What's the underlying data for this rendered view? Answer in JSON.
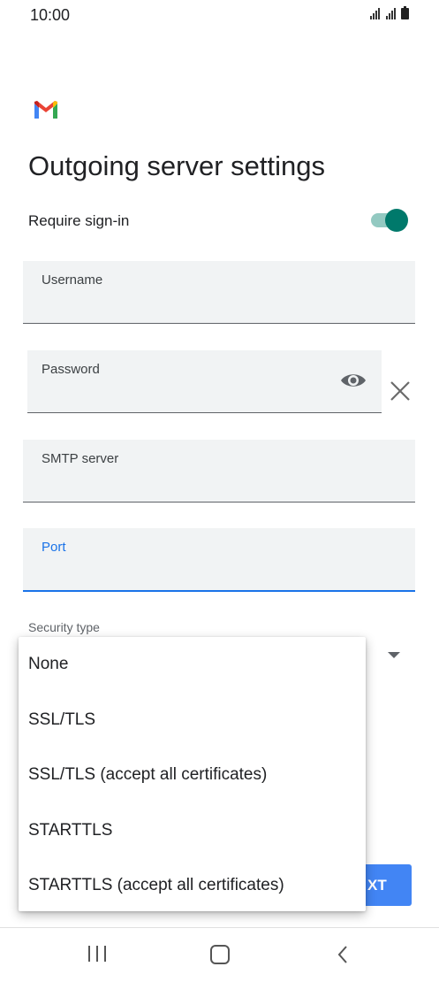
{
  "status_bar": {
    "time": "10:00"
  },
  "page": {
    "title": "Outgoing server settings"
  },
  "require_signin": {
    "label": "Require sign-in",
    "enabled": true
  },
  "fields": {
    "username": {
      "label": "Username",
      "value": ""
    },
    "password": {
      "label": "Password",
      "value": ""
    },
    "smtp_server": {
      "label": "SMTP server",
      "value": ""
    },
    "port": {
      "label": "Port",
      "value": ""
    }
  },
  "security": {
    "label": "Security type",
    "options": [
      "None",
      "SSL/TLS",
      "SSL/TLS (accept all certificates)",
      "STARTTLS",
      "STARTTLS (accept all certificates)"
    ]
  },
  "next_button": {
    "label": "NEXT",
    "visible_text": "XT"
  },
  "colors": {
    "accent": "#1a73e8",
    "toggle": "#00796b",
    "button": "#4285f4"
  },
  "icons": [
    "gmail-logo",
    "visibility-icon",
    "clear-icon",
    "dropdown-arrow-icon",
    "recents-icon",
    "home-icon",
    "back-icon"
  ]
}
